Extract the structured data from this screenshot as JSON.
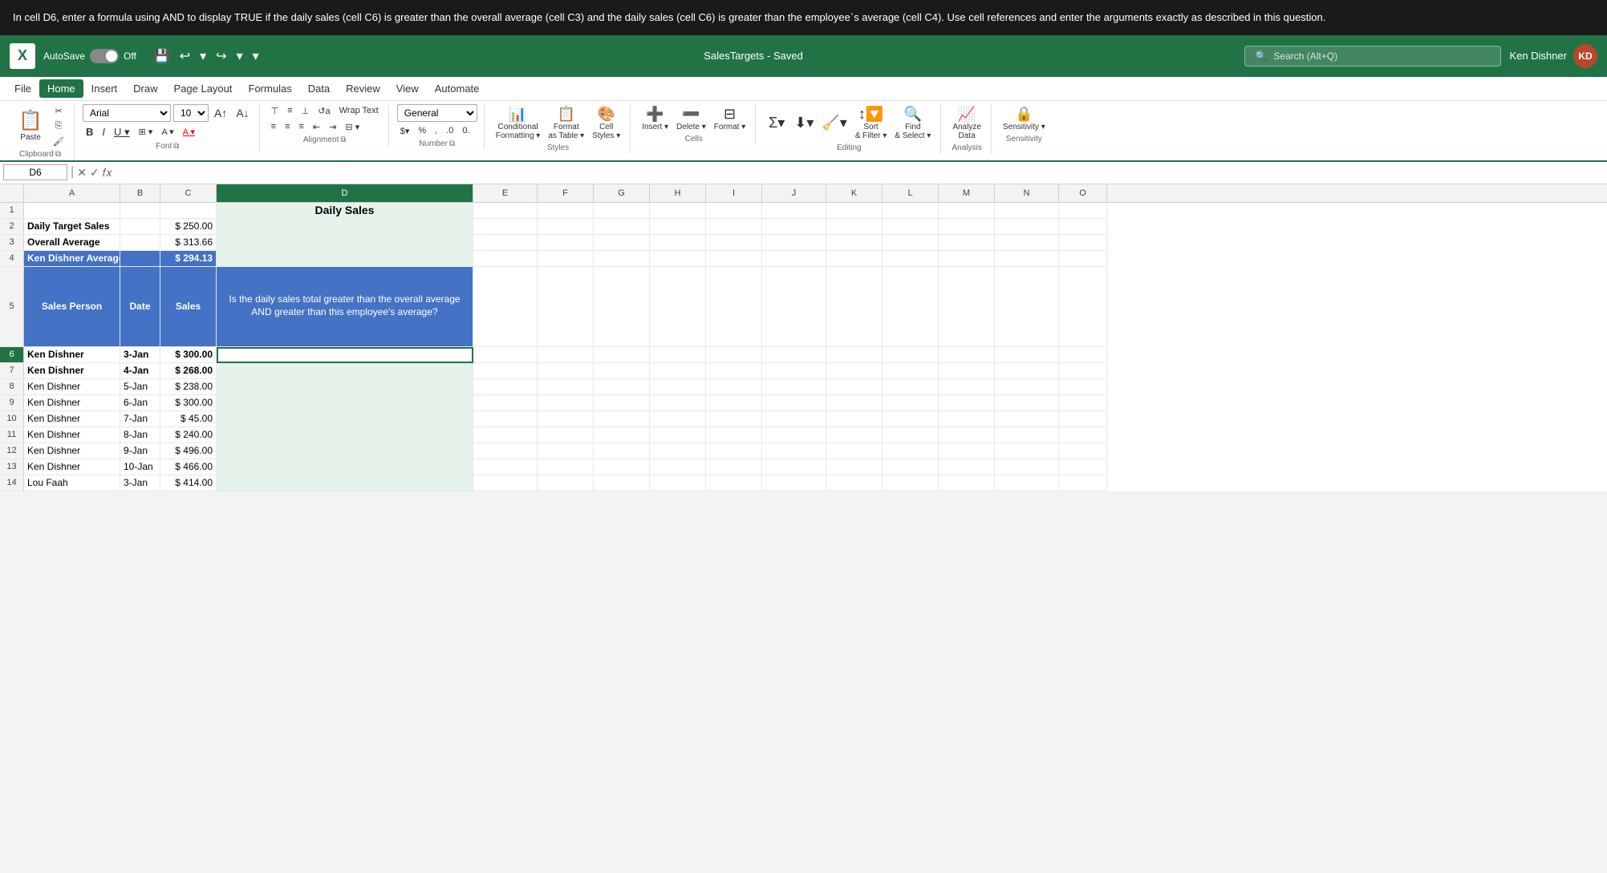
{
  "instruction": {
    "text": "In cell D6, enter a formula using AND to display TRUE if the daily sales (cell C6) is greater than the overall average (cell C3) and the daily sales (cell C6) is greater than the employee`s average (cell C4). Use cell references and enter the arguments exactly as described in this question."
  },
  "titlebar": {
    "autosave_label": "AutoSave",
    "off_label": "Off",
    "filename": "SalesTargets - Saved",
    "search_placeholder": "Search (Alt+Q)",
    "user_name": "Ken Dishner",
    "user_initials": "KD"
  },
  "menubar": {
    "items": [
      "File",
      "Home",
      "Insert",
      "Draw",
      "Page Layout",
      "Formulas",
      "Data",
      "Review",
      "View",
      "Automate"
    ]
  },
  "ribbon": {
    "clipboard_label": "Clipboard",
    "font_label": "Font",
    "alignment_label": "Alignment",
    "number_label": "Number",
    "styles_label": "Styles",
    "cells_label": "Cells",
    "editing_label": "Editing",
    "analysis_label": "Analysis",
    "sensitivity_label": "Sensitivity",
    "paste_label": "Paste",
    "font_name": "Arial",
    "font_size": "10",
    "wrap_text": "Wrap Text",
    "merge_center": "Merge & Center",
    "number_format": "General",
    "conditional_formatting": "Conditional\nFormatting",
    "format_as_table": "Format\nas Table",
    "cell_styles": "Cell\nStyles",
    "insert_label": "Insert",
    "delete_label": "Delete",
    "format_label": "Format",
    "sort_filter": "Sort\n& Filter",
    "find_select": "Find\n& Select",
    "analyze_data": "Analyze\nData"
  },
  "formula_bar": {
    "cell_ref": "D6",
    "formula": ""
  },
  "columns": {
    "headers": [
      "",
      "A",
      "B",
      "C",
      "D",
      "E",
      "F",
      "G",
      "H",
      "I",
      "J",
      "K",
      "L",
      "M",
      "N",
      "O"
    ]
  },
  "spreadsheet": {
    "title": "Daily Sales",
    "row2": {
      "label": "Daily Target Sales",
      "currency": "$",
      "value": "250.00"
    },
    "row3": {
      "label": "Overall Average",
      "currency": "$",
      "value": "313.66"
    },
    "row4": {
      "label": "Ken Dishner Average",
      "currency": "$",
      "value": "294.13"
    },
    "row5_header": {
      "col_a": "Sales Person",
      "col_b": "Date",
      "col_c": "Sales",
      "col_d": "Is the daily sales total greater than the overall average AND greater than this employee's average?"
    },
    "data_rows": [
      {
        "row": 6,
        "person": "Ken Dishner",
        "date": "3-Jan",
        "currency": "$",
        "sales": "300.00"
      },
      {
        "row": 7,
        "person": "Ken Dishner",
        "date": "4-Jan",
        "currency": "$",
        "sales": "268.00"
      },
      {
        "row": 8,
        "person": "Ken Dishner",
        "date": "5-Jan",
        "currency": "$",
        "sales": "238.00"
      },
      {
        "row": 9,
        "person": "Ken Dishner",
        "date": "6-Jan",
        "currency": "$",
        "sales": "300.00"
      },
      {
        "row": 10,
        "person": "Ken Dishner",
        "date": "7-Jan",
        "currency": "$",
        "sales": "45.00"
      },
      {
        "row": 11,
        "person": "Ken Dishner",
        "date": "8-Jan",
        "currency": "$",
        "sales": "240.00"
      },
      {
        "row": 12,
        "person": "Ken Dishner",
        "date": "9-Jan",
        "currency": "$",
        "sales": "496.00"
      },
      {
        "row": 13,
        "person": "Ken Dishner",
        "date": "10-Jan",
        "currency": "$",
        "sales": "466.00"
      },
      {
        "row": 14,
        "person": "Lou Faah",
        "date": "3-Jan",
        "currency": "$",
        "sales": "414.00"
      }
    ]
  },
  "colors": {
    "excel_green": "#217346",
    "header_blue": "#4472c4",
    "highlight_blue": "#4472c4",
    "instruction_bg": "#1a1a1a",
    "title_bar_green": "#217346"
  }
}
